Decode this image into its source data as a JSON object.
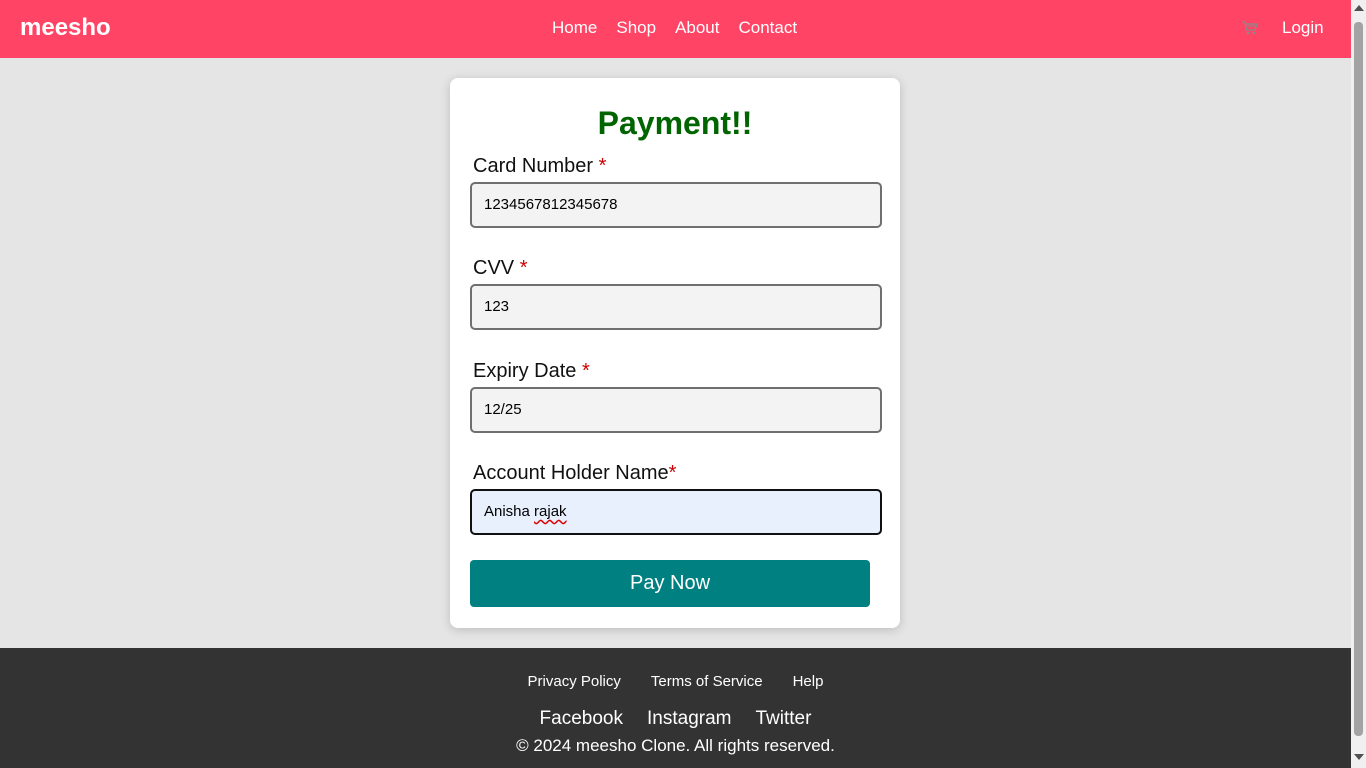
{
  "header": {
    "logo": "meesho",
    "nav": [
      "Home",
      "Shop",
      "About",
      "Contact"
    ],
    "cart_icon": "cart-icon",
    "login": "Login"
  },
  "form": {
    "title": "Payment!!",
    "required_marker": "*",
    "fields": [
      {
        "label": "Card Number",
        "value": "1234567812345678"
      },
      {
        "label": "CVV",
        "value": "123"
      },
      {
        "label": "Expiry Date",
        "value": "12/25"
      },
      {
        "label": "Account Holder Name",
        "value_first": "Anisha",
        "value_second": "rajak"
      }
    ],
    "submit": "Pay Now"
  },
  "footer": {
    "links": [
      "Privacy Policy",
      "Terms of Service",
      "Help"
    ],
    "social": [
      "Facebook",
      "Instagram",
      "Twitter"
    ],
    "copyright": "© 2024 meesho Clone. All rights reserved."
  },
  "colors": {
    "header_bg": "#ff4466",
    "title": "#006400",
    "button": "#008080",
    "footer_bg": "#333333",
    "required": "#cc0000"
  }
}
